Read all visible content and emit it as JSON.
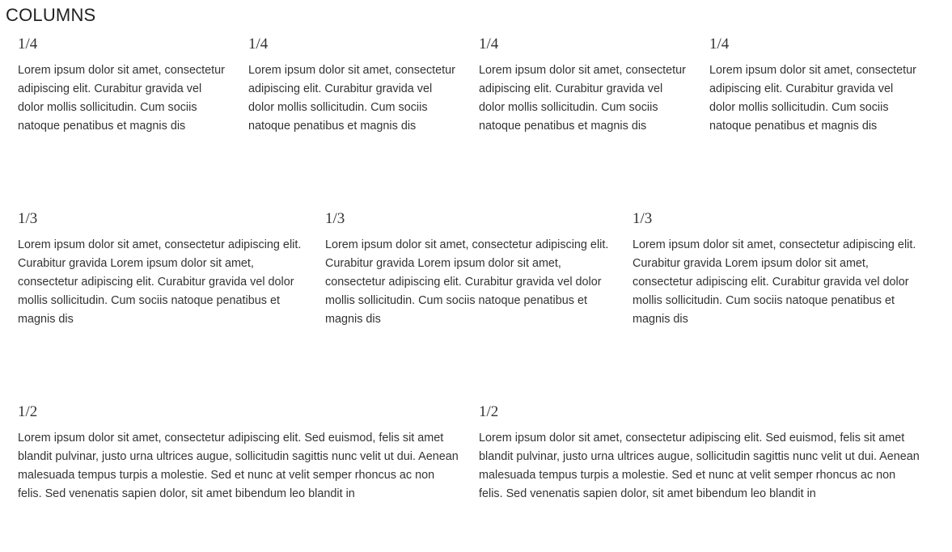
{
  "page": {
    "title": "COLUMNS"
  },
  "rows": {
    "quarters": [
      {
        "heading": "1/4",
        "text": "Lorem ipsum dolor sit amet, consectetur adipiscing elit. Curabitur gravida vel dolor mollis sollicitudin. Cum sociis natoque penatibus et magnis dis"
      },
      {
        "heading": "1/4",
        "text": "Lorem ipsum dolor sit amet, consectetur adipiscing elit. Curabitur gravida vel dolor mollis sollicitudin. Cum sociis natoque penatibus et magnis dis"
      },
      {
        "heading": "1/4",
        "text": "Lorem ipsum dolor sit amet, consectetur adipiscing elit. Curabitur gravida vel dolor mollis sollicitudin. Cum sociis natoque penatibus et magnis dis"
      },
      {
        "heading": "1/4",
        "text": "Lorem ipsum dolor sit amet, consectetur adipiscing elit. Curabitur gravida vel dolor mollis sollicitudin. Cum sociis natoque penatibus et magnis dis"
      }
    ],
    "thirds": [
      {
        "heading": "1/3",
        "text": "Lorem ipsum dolor sit amet, consectetur adipiscing elit. Curabitur gravida Lorem ipsum dolor sit amet, consectetur adipiscing elit. Curabitur gravida vel dolor mollis sollicitudin. Cum sociis natoque penatibus et magnis dis"
      },
      {
        "heading": "1/3",
        "text": "Lorem ipsum dolor sit amet, consectetur adipiscing elit. Curabitur gravida Lorem ipsum dolor sit amet, consectetur adipiscing elit. Curabitur gravida vel dolor mollis sollicitudin. Cum sociis natoque penatibus et magnis dis"
      },
      {
        "heading": "1/3",
        "text": "Lorem ipsum dolor sit amet, consectetur adipiscing elit. Curabitur gravida Lorem ipsum dolor sit amet, consectetur adipiscing elit. Curabitur gravida vel dolor mollis sollicitudin. Cum sociis natoque penatibus et magnis dis"
      }
    ],
    "halves": [
      {
        "heading": "1/2",
        "text": "Lorem ipsum dolor sit amet, consectetur adipiscing elit. Sed euismod, felis sit amet blandit pulvinar, justo urna ultrices augue, sollicitudin sagittis nunc velit ut dui. Aenean malesuada tempus turpis a molestie. Sed et nunc at velit semper rhoncus ac non felis. Sed venenatis sapien dolor, sit amet bibendum leo blandit in"
      },
      {
        "heading": "1/2",
        "text": "Lorem ipsum dolor sit amet, consectetur adipiscing elit. Sed euismod, felis sit amet blandit pulvinar, justo urna ultrices augue, sollicitudin sagittis nunc velit ut dui. Aenean malesuada tempus turpis a molestie. Sed et nunc at velit semper rhoncus ac non felis. Sed venenatis sapien dolor, sit amet bibendum leo blandit in"
      }
    ]
  }
}
